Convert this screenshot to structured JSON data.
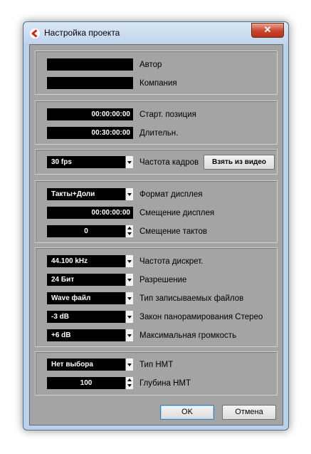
{
  "window": {
    "title": "Настройка проекта",
    "close_glyph": "✕"
  },
  "info": {
    "author_value": "",
    "author_label": "Автор",
    "company_value": "",
    "company_label": "Компания"
  },
  "timing": {
    "start_value": "00:00:00:00",
    "start_label": "Старт. позиция",
    "length_value": "00:30:00:00",
    "length_label": "Длительн."
  },
  "frames": {
    "fps_value": "30 fps",
    "fps_label": "Частота кадров",
    "from_video_button": "Взять из видео"
  },
  "display": {
    "format_value": "Такты+Доли",
    "format_label": "Формат дисплея",
    "offset_value": "00:00:00:00",
    "offset_label": "Смещение дисплея",
    "bar_offset_value": "0",
    "bar_offset_label": "Смещение тактов"
  },
  "audio": {
    "sample_rate_value": "44.100 kHz",
    "sample_rate_label": "Частота дискрет.",
    "bit_depth_value": "24 Бит",
    "bit_depth_label": "Разрешение",
    "file_type_value": "Wave файл",
    "file_type_label": "Тип записываемых файлов",
    "pan_law_value": "-3 dB",
    "pan_law_label": "Закон панорамирования Стерео",
    "max_volume_value": "+6 dB",
    "max_volume_label": "Максимальная громкость"
  },
  "hmt": {
    "type_value": "Нет выбора",
    "type_label": "Тип НМТ",
    "depth_value": "100",
    "depth_label": "Глубина НМТ"
  },
  "buttons": {
    "ok": "OK",
    "cancel": "Отмена"
  }
}
